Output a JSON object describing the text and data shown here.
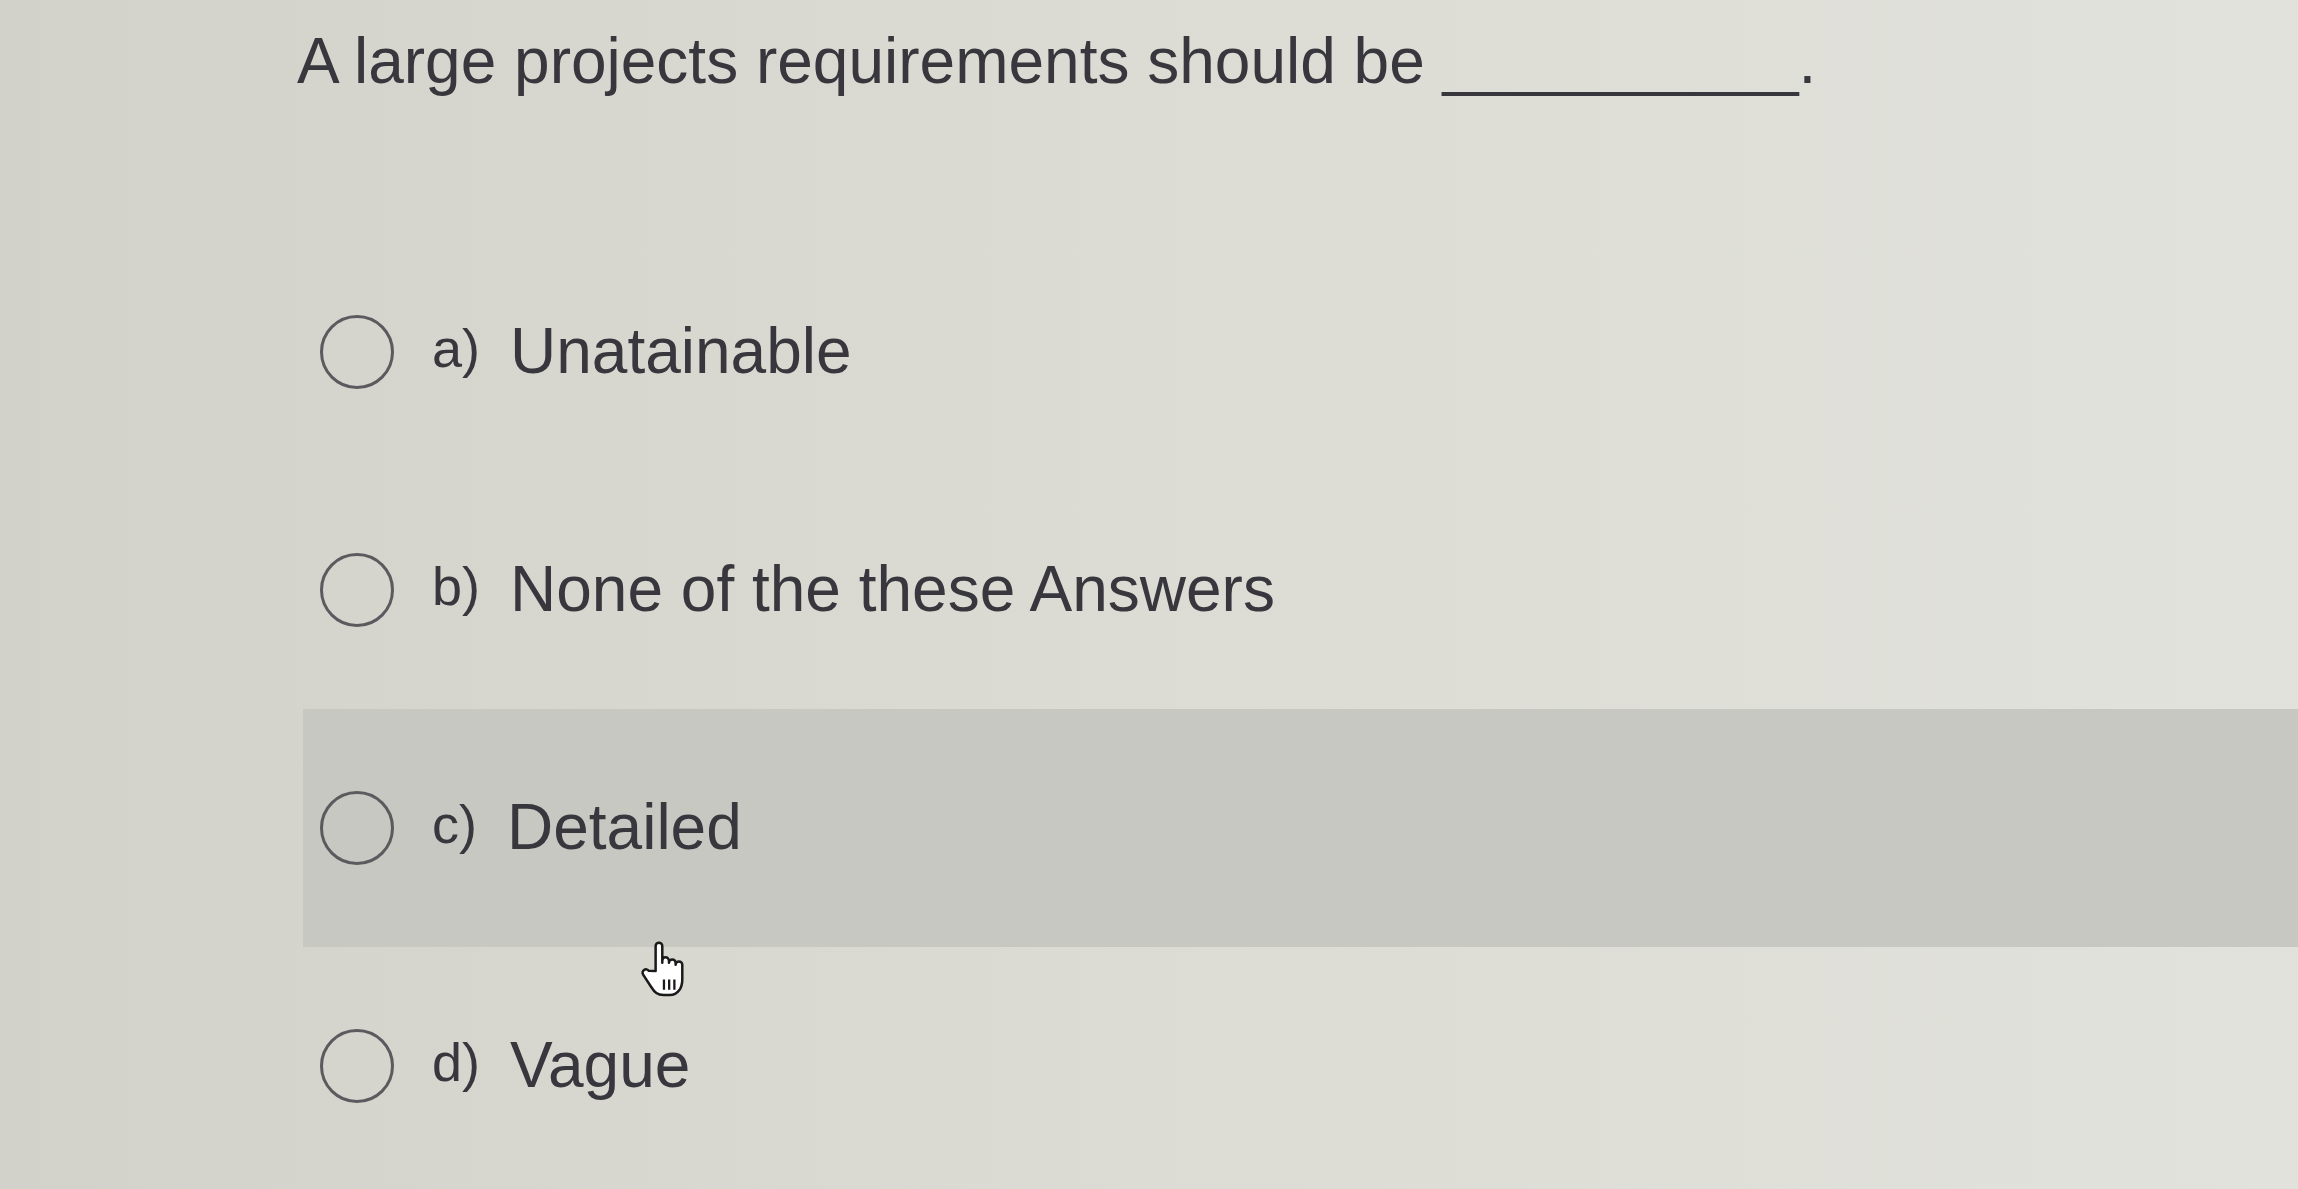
{
  "question": {
    "text": "A large projects requirements should be __________."
  },
  "options": [
    {
      "letter": "a)",
      "text": "Unatainable",
      "selected": false,
      "hovered": false
    },
    {
      "letter": "b)",
      "text": "None of the these Answers",
      "selected": false,
      "hovered": false
    },
    {
      "letter": "c)",
      "text": "Detailed",
      "selected": false,
      "hovered": true
    },
    {
      "letter": "d)",
      "text": "Vague",
      "selected": false,
      "hovered": false
    }
  ]
}
